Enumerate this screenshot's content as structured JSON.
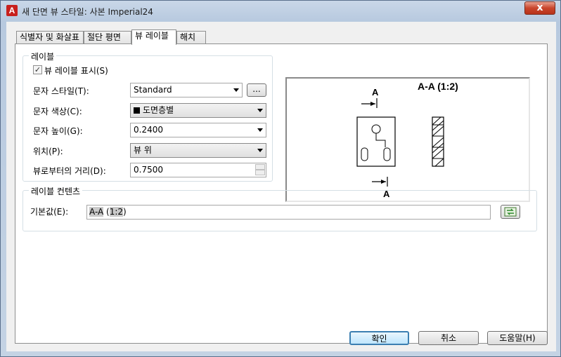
{
  "window": {
    "title": "새 단면 뷰 스타일: 사본 Imperial24",
    "close_label": "x"
  },
  "tabs": [
    {
      "label": "식별자 및 화살표"
    },
    {
      "label": "절단 평면"
    },
    {
      "label": "뷰 레이블"
    },
    {
      "label": "해치"
    }
  ],
  "label_group": {
    "title": "레이블",
    "show_label": {
      "label": "뷰 레이블 표시(S)",
      "checked": true
    },
    "text_style": {
      "label": "문자 스타일(T):",
      "value": "Standard",
      "browse_label": "..."
    },
    "text_color": {
      "label": "문자 색상(C):",
      "value": "도면층별",
      "swatch": "#000000"
    },
    "text_height": {
      "label": "문자 높이(G):",
      "value": "0.2400"
    },
    "position": {
      "label": "위치(P):",
      "value": "뷰 위"
    },
    "distance": {
      "label": "뷰로부터의 거리(D):",
      "value": "0.7500"
    }
  },
  "preview": {
    "title_text": "A-A (1:2)",
    "top_letter": "A",
    "bottom_letter": "A"
  },
  "content_group": {
    "title": "레이블 컨텐츠",
    "default_label": "기본값(E):",
    "default_value_a": "A-A",
    "default_value_b": "1:2"
  },
  "buttons": {
    "ok": "확인",
    "cancel": "취소",
    "help": "도움말(H)"
  }
}
